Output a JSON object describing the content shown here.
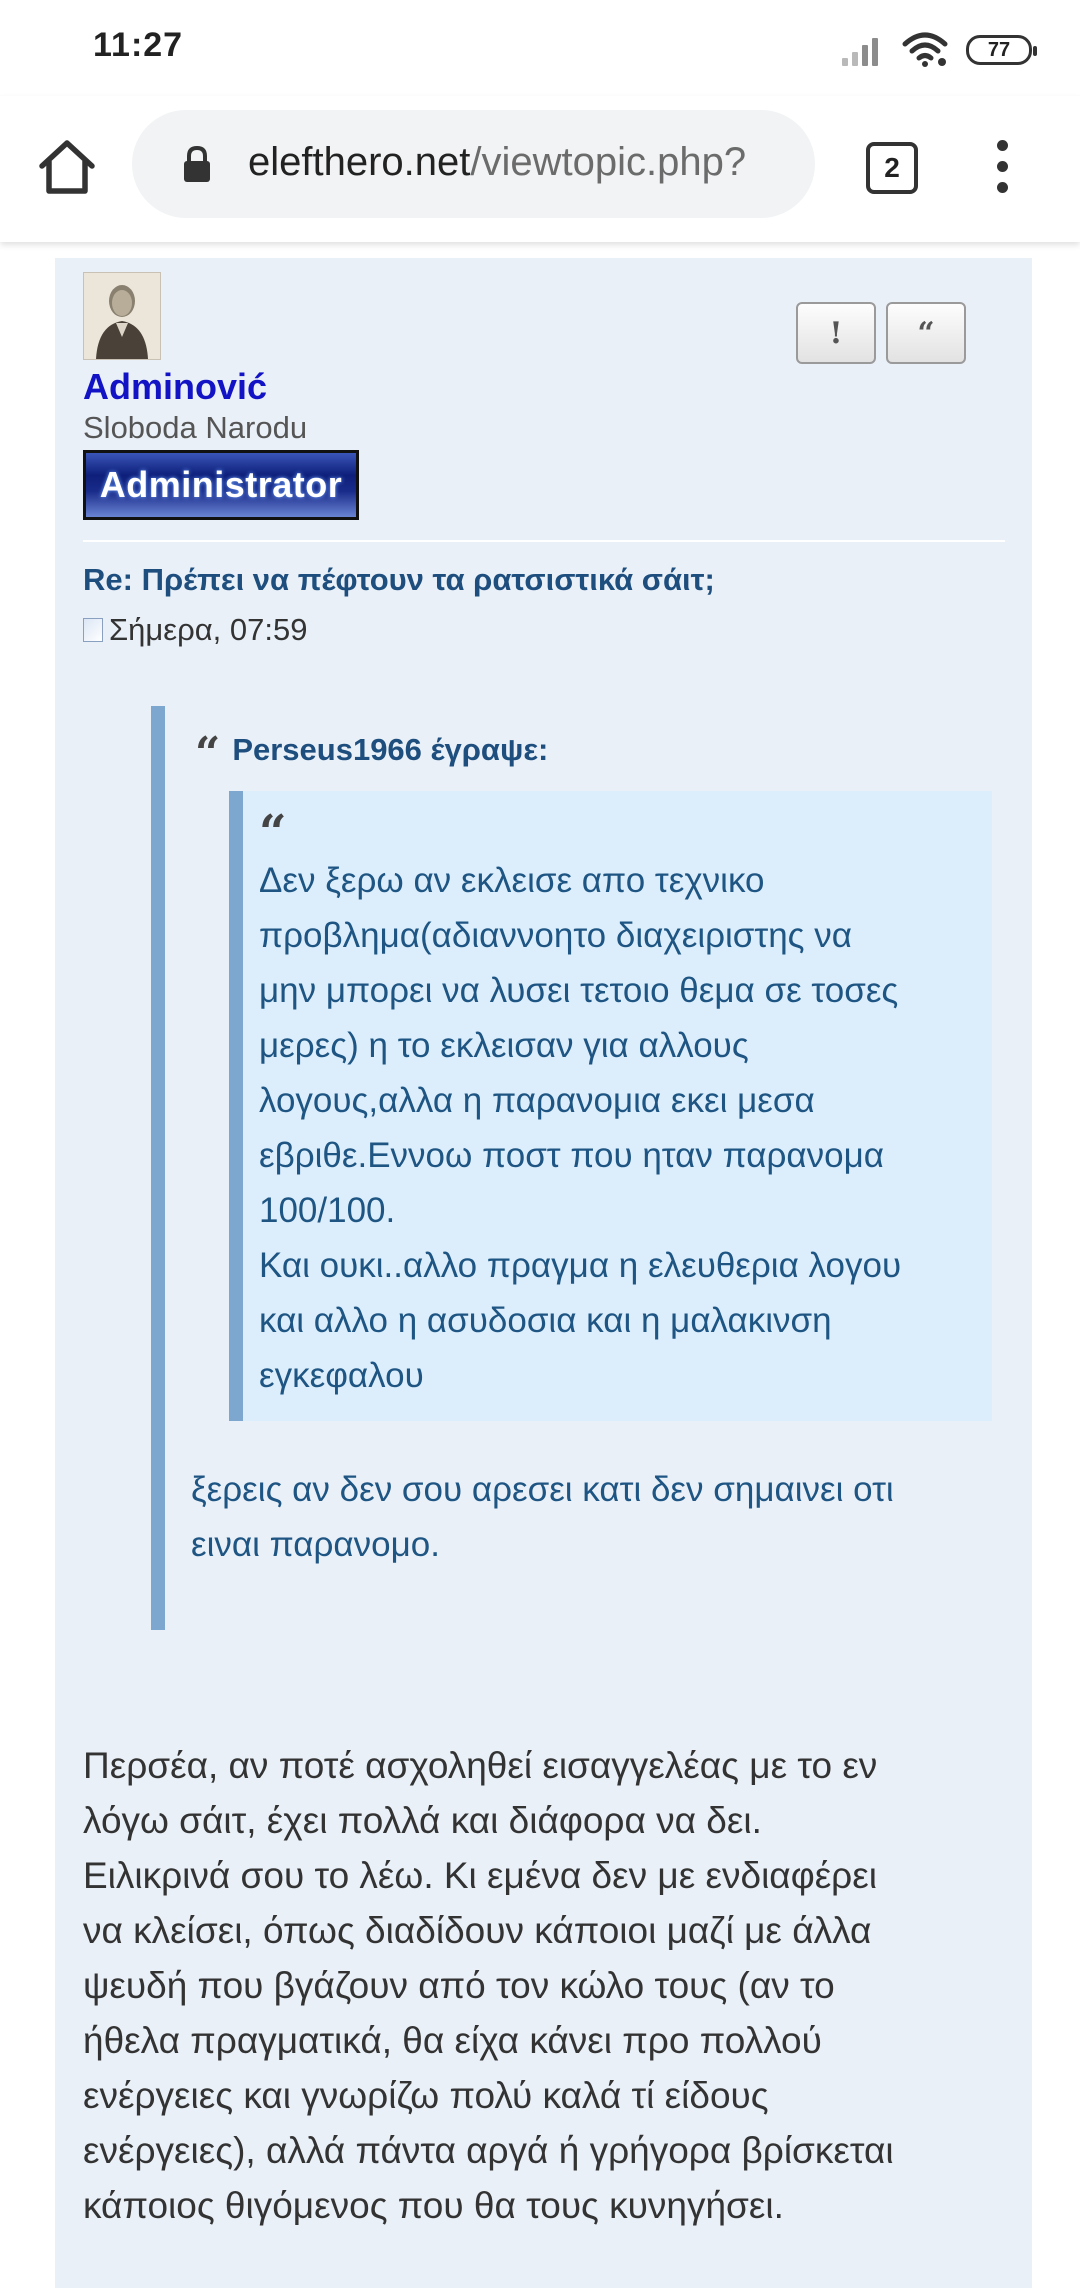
{
  "status_bar": {
    "time": "11:27",
    "battery": "77",
    "icons": [
      "signal-icon",
      "wifi-icon",
      "battery-icon"
    ]
  },
  "browser": {
    "url_domain": "elefthero.net",
    "url_path": "/viewtopic.php?",
    "tab_count": "2",
    "icons": [
      "home-icon",
      "lock-icon",
      "tabs-icon",
      "menu-icon"
    ]
  },
  "post": {
    "author": "Adminović",
    "author_title": "Sloboda Narodu",
    "rank": "Administrator",
    "report_button": "!",
    "quote_button": "“",
    "subject": "Re: Πρέπει να πέφτουν τα ρατσιστικά σάιτ;",
    "date": "Σήμερα, 07:59",
    "quote": {
      "mark": "“",
      "cite": "Perseus1966 έγραψε:",
      "inner_text": "Δεν ξερω αν εκλεισε απο τεχνικο\nπροβλημα(αδιαννοητο διαχειριστης να\nμην μπορει να λυσει τετοιο θεμα σε τοσες\nμερες) η το εκλεισαν για αλλους\nλογους,αλλα η παρανομια εκει μεσα\nεβριθε.Εννοω ποστ που ηταν παρανομα\n100/100.\nΚαι ουκι..αλλο πραγμα η ελευθερια λογου\nκαι αλλο η ασυδοσια και η μαλακινση\nεγκεφαλου",
      "outer_text": "ξερεις αν δεν σου αρεσει κατι δεν σημαινει οτι\nειναι παρανομο."
    },
    "body": "Περσέα, αν ποτέ ασχοληθεί εισαγγελέας με το εν\nλόγω σάιτ, έχει πολλά και διάφορα να δει.\nΕιλικρινά σου το λέω. Κι εμένα δεν με ενδιαφέρει\nνα κλείσει, όπως διαδίδουν κάποιοι μαζί με άλλα\nψευδή που βγάζουν από τον κώλο τους (αν το\nήθελα πραγματικά, θα είχα κάνει προ πολλού\nενέργειες και γνωρίζω πολύ καλά τί είδους\nενέργειες), αλλά πάντα αργά ή γρήγορα βρίσκεται\nκάποιος θιγόμενος που θα τους κυνηγήσει."
  },
  "colors": {
    "post_background": "#e9f0f8",
    "quote_border": "#7ea7cf",
    "inner_quote_background": "#dceefc",
    "link_blue": "#1e4e7d",
    "username_blue": "#1313c6"
  }
}
